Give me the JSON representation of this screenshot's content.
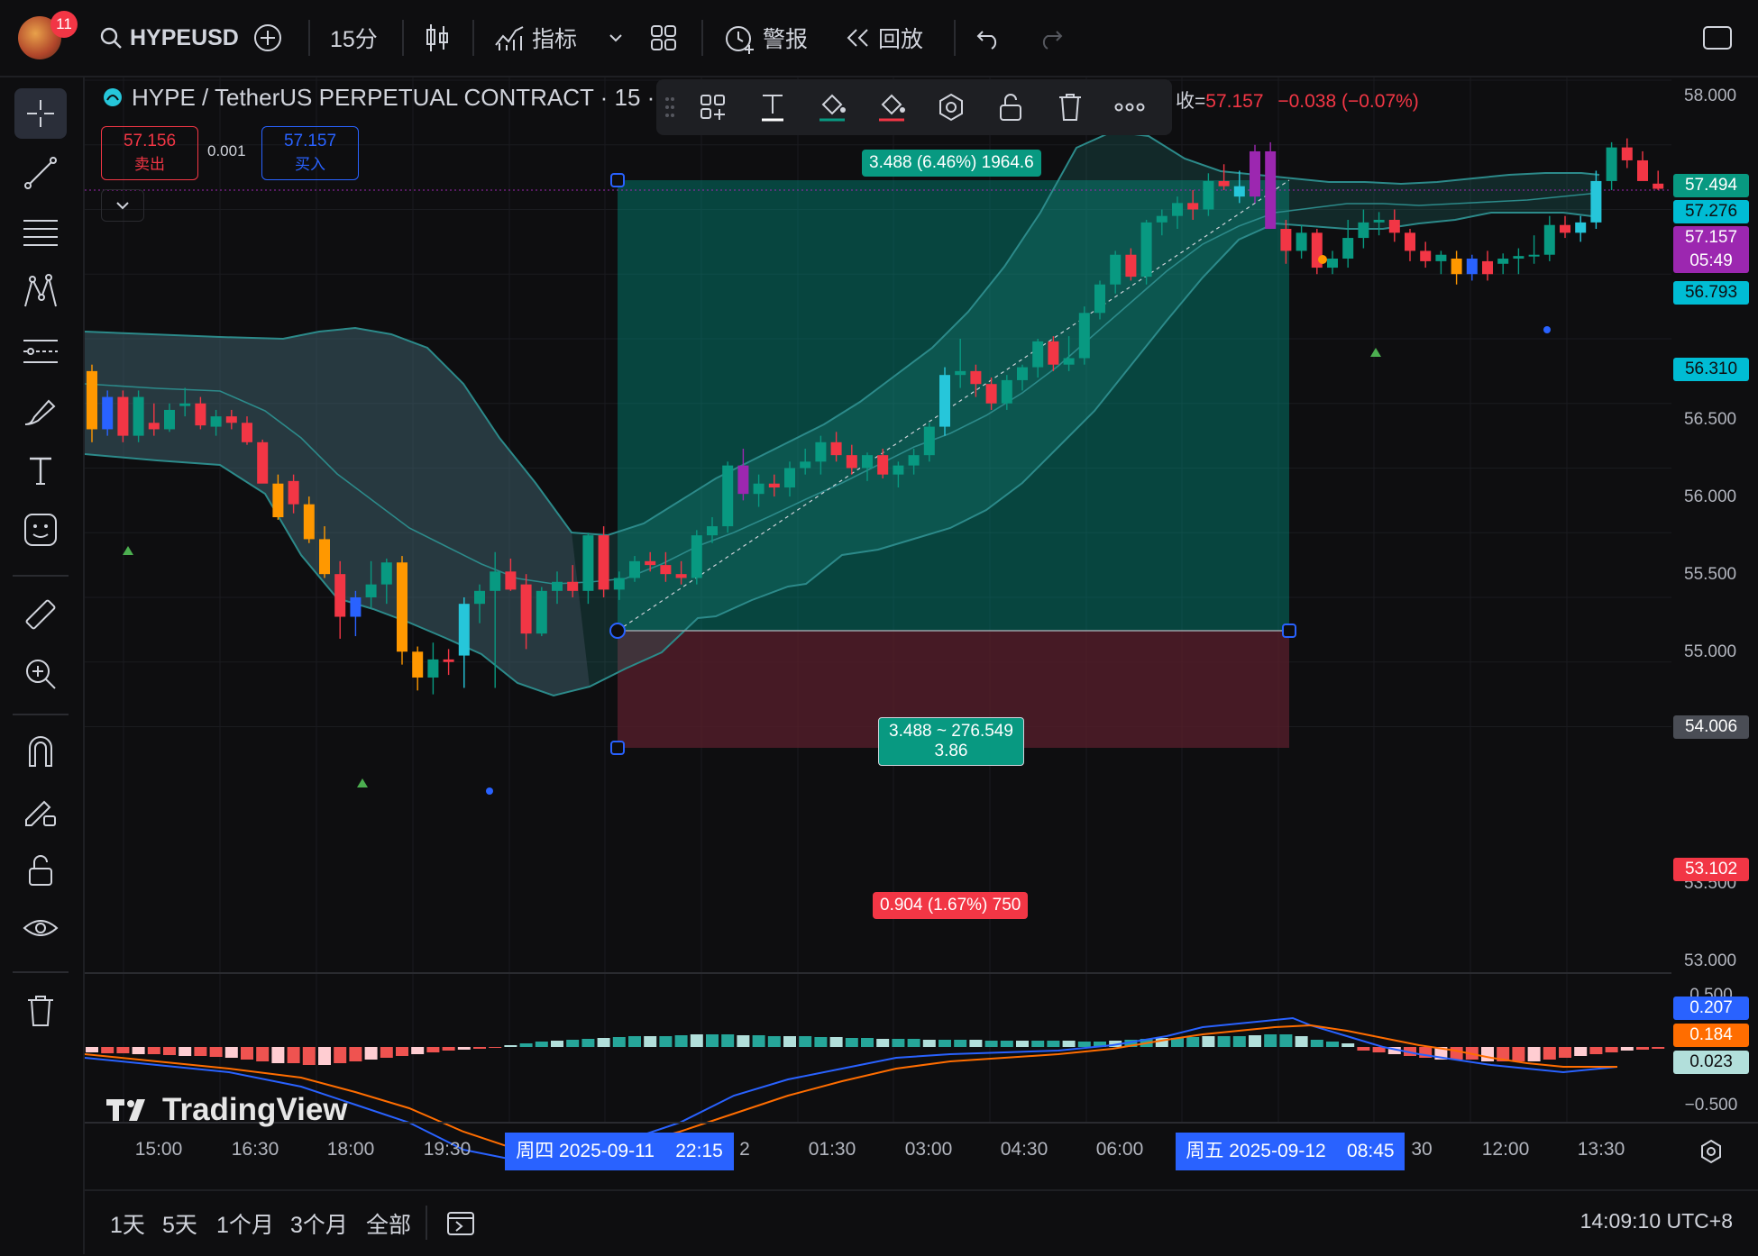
{
  "topbar": {
    "notification_count": "11",
    "symbol": "HYPEUSD",
    "interval": "15分",
    "indicators_label": "指标",
    "alerts_label": "警报",
    "replay_label": "回放"
  },
  "legend": {
    "title": "HYPE / TetherUS PERPETUAL CONTRACT · 15 ·",
    "close_label": "收=",
    "close_value": "57.157",
    "change": "−0.038 (−0.07%)",
    "sell_price": "57.156",
    "sell_label": "卖出",
    "spread": "0.001",
    "buy_price": "57.157",
    "buy_label": "买入"
  },
  "position_tool": {
    "target_label": "3.488 (6.46%) 1964.6",
    "center_label_line1": "3.488 ~ 276.549",
    "center_label_line2": "3.86",
    "stop_label": "0.904 (1.67%) 750"
  },
  "price_axis": {
    "ticks": [
      "58.000",
      "57.500",
      "56.500",
      "56.000",
      "55.500",
      "55.000",
      "54.500",
      "53.500",
      "53.000"
    ],
    "labels": [
      {
        "text": "57.494",
        "bg": "#089981",
        "fg": "#ffffff"
      },
      {
        "text": "57.276",
        "bg": "#00bcd4",
        "fg": "#0e0e10"
      },
      {
        "text": "57.157",
        "sub": "05:49",
        "bg": "#9c27b0",
        "fg": "#ffffff"
      },
      {
        "text": "56.793",
        "bg": "#00bcd4",
        "fg": "#0e0e10"
      },
      {
        "text": "56.310",
        "bg": "#00bcd4",
        "fg": "#0e0e10"
      },
      {
        "text": "54.006",
        "bg": "#4a4d55",
        "fg": "#ffffff"
      },
      {
        "text": "53.102",
        "bg": "#f23645",
        "fg": "#ffffff"
      }
    ]
  },
  "macd_axis": {
    "top_tick": "0.500",
    "bottom_tick": "−0.500",
    "macd_value": "0.207",
    "signal_value": "0.184",
    "hist_value": "0.023"
  },
  "time_axis": {
    "ticks": [
      "15:00",
      "16:30",
      "18:00",
      "19:30",
      "2",
      "01:30",
      "03:00",
      "04:30",
      "06:00",
      "30",
      "12:00",
      "13:30"
    ],
    "start_label": "周四 2025-09-11    22:15",
    "end_label": "周五 2025-09-12    08:45"
  },
  "watermark": "TradingView",
  "bottombar": {
    "ranges": [
      "1天",
      "5天",
      "1个月",
      "3个月",
      "全部"
    ],
    "clock": "14:09:10 UTC+8"
  },
  "colors": {
    "up": "#089981",
    "down": "#f23645",
    "accent": "#2962ff"
  }
}
